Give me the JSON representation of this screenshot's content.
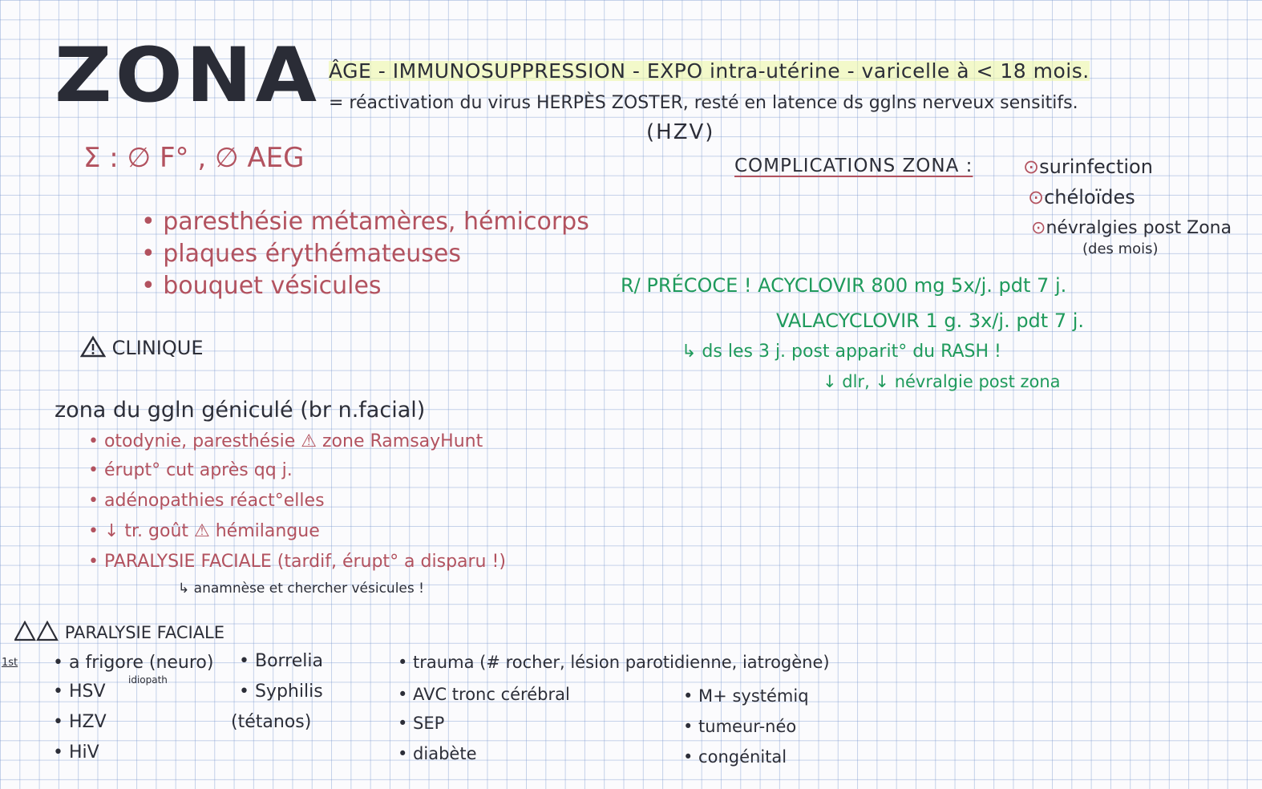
{
  "title": "ZONA",
  "header": {
    "line1": "ÂGE - IMMUNOSUPPRESSION - EXPO intra-utérine - varicelle à < 18 mois.",
    "line2": "= réactivation du virus HERPÈS ZOSTER, resté en latence ds gglns nerveux sensitifs.",
    "line3": "(HZV)"
  },
  "signs": {
    "heading": "Σ :   ∅ F°  , ∅ AEG",
    "items": [
      "• paresthésie métamères, hémicorps",
      "• plaques érythémateuses",
      "• bouquet vésicules"
    ]
  },
  "clinique": {
    "icon": "warning-triangle-icon",
    "label": "CLINIQUE"
  },
  "complications": {
    "heading": "COMPLICATIONS ZONA :",
    "items": [
      "surinfection",
      "chéloïdes",
      "névralgies post Zona"
    ],
    "note": "(des mois)"
  },
  "treatment": {
    "line1": "R/ PRÉCOCE !   ACYCLOVIR   800 mg 5x/j.  pdt 7 j.",
    "line2": "VALACYCLOVIR   1 g.   3x/j.   pdt 7 j.",
    "line3": "↳ ds les 3 j. post apparit° du RASH !",
    "line4": "↓ dlr, ↓ névralgie post zona"
  },
  "zona_ganglion": {
    "heading": "zona du ggln géniculé (br n.facial)",
    "items": [
      "• otodynie, paresthésie ⚠ zone RamsayHunt",
      "• érupt° cut après qq j.",
      "• adénopathies réact°elles",
      "• ↓ tr. goût ⚠ hémilangue",
      "• PARALYSIE FACIALE (tardif, érupt° a disparu !)"
    ],
    "note": "↳ anamnèse et chercher vésicules !"
  },
  "paralysie": {
    "icon": "double-warning-triangle-icon",
    "heading": "PARALYSIE FACIALE",
    "side_note": "1st",
    "col1": [
      "• a frigore (neuro)",
      "• HSV",
      "• HZV",
      "• HiV"
    ],
    "col1_note": "idiopath",
    "col2": [
      "• Borrelia",
      "• Syphilis",
      "(tétanos)"
    ],
    "col3": [
      "• trauma (# rocher, lésion parotidienne, iatrogène)",
      "• AVC tronc cérébral",
      "• SEP",
      "• diabète"
    ],
    "col4": [
      "• M+ systémiq",
      "• tumeur-néo",
      "• congénital"
    ]
  },
  "colors": {
    "ink": "#2c2e38",
    "red": "#b2525f",
    "green": "#1f9a5c",
    "grid": "#7896cd",
    "highlight": "#ecf8a0"
  }
}
